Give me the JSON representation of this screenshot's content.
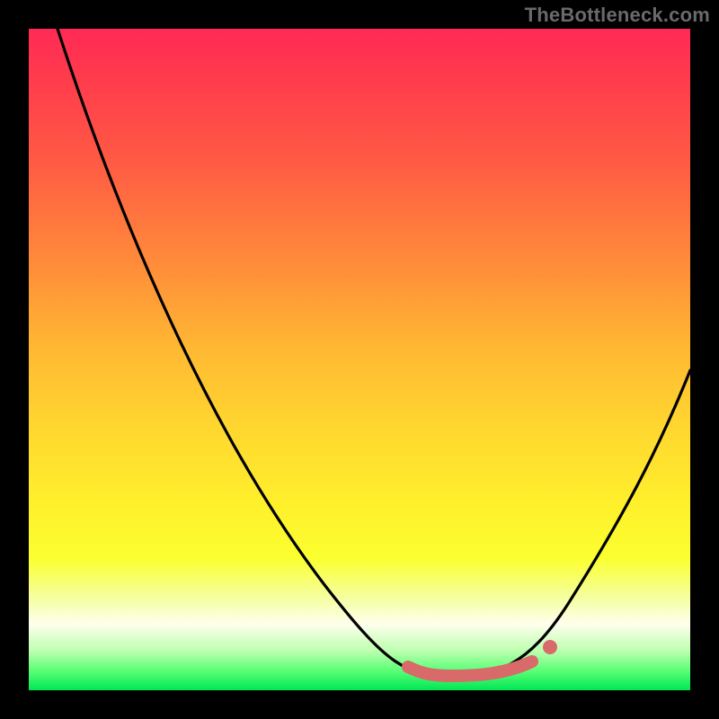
{
  "watermark": "TheBottleneck.com",
  "colors": {
    "curve": "#000000",
    "marker": "#d86a6a",
    "frame": "#000000"
  },
  "chart_data": {
    "type": "line",
    "title": "",
    "xlabel": "",
    "ylabel": "",
    "xlim": [
      0,
      100
    ],
    "ylim": [
      0,
      100
    ],
    "x": [
      0,
      5,
      10,
      15,
      20,
      25,
      30,
      35,
      40,
      45,
      50,
      55,
      58,
      60,
      63,
      66,
      70,
      75,
      80,
      85,
      90,
      95,
      100
    ],
    "values": [
      100,
      92,
      84,
      75,
      66,
      57,
      48,
      40,
      31,
      23,
      15,
      8,
      4,
      2,
      1,
      1,
      2,
      5,
      12,
      22,
      33,
      43,
      50
    ],
    "marker": {
      "x_start": 57,
      "x_end": 76,
      "dot_x": 79,
      "note": "highlighted optimal range at curve minimum"
    },
    "background": "vertical gradient red→orange→yellow→green (top→bottom)"
  }
}
